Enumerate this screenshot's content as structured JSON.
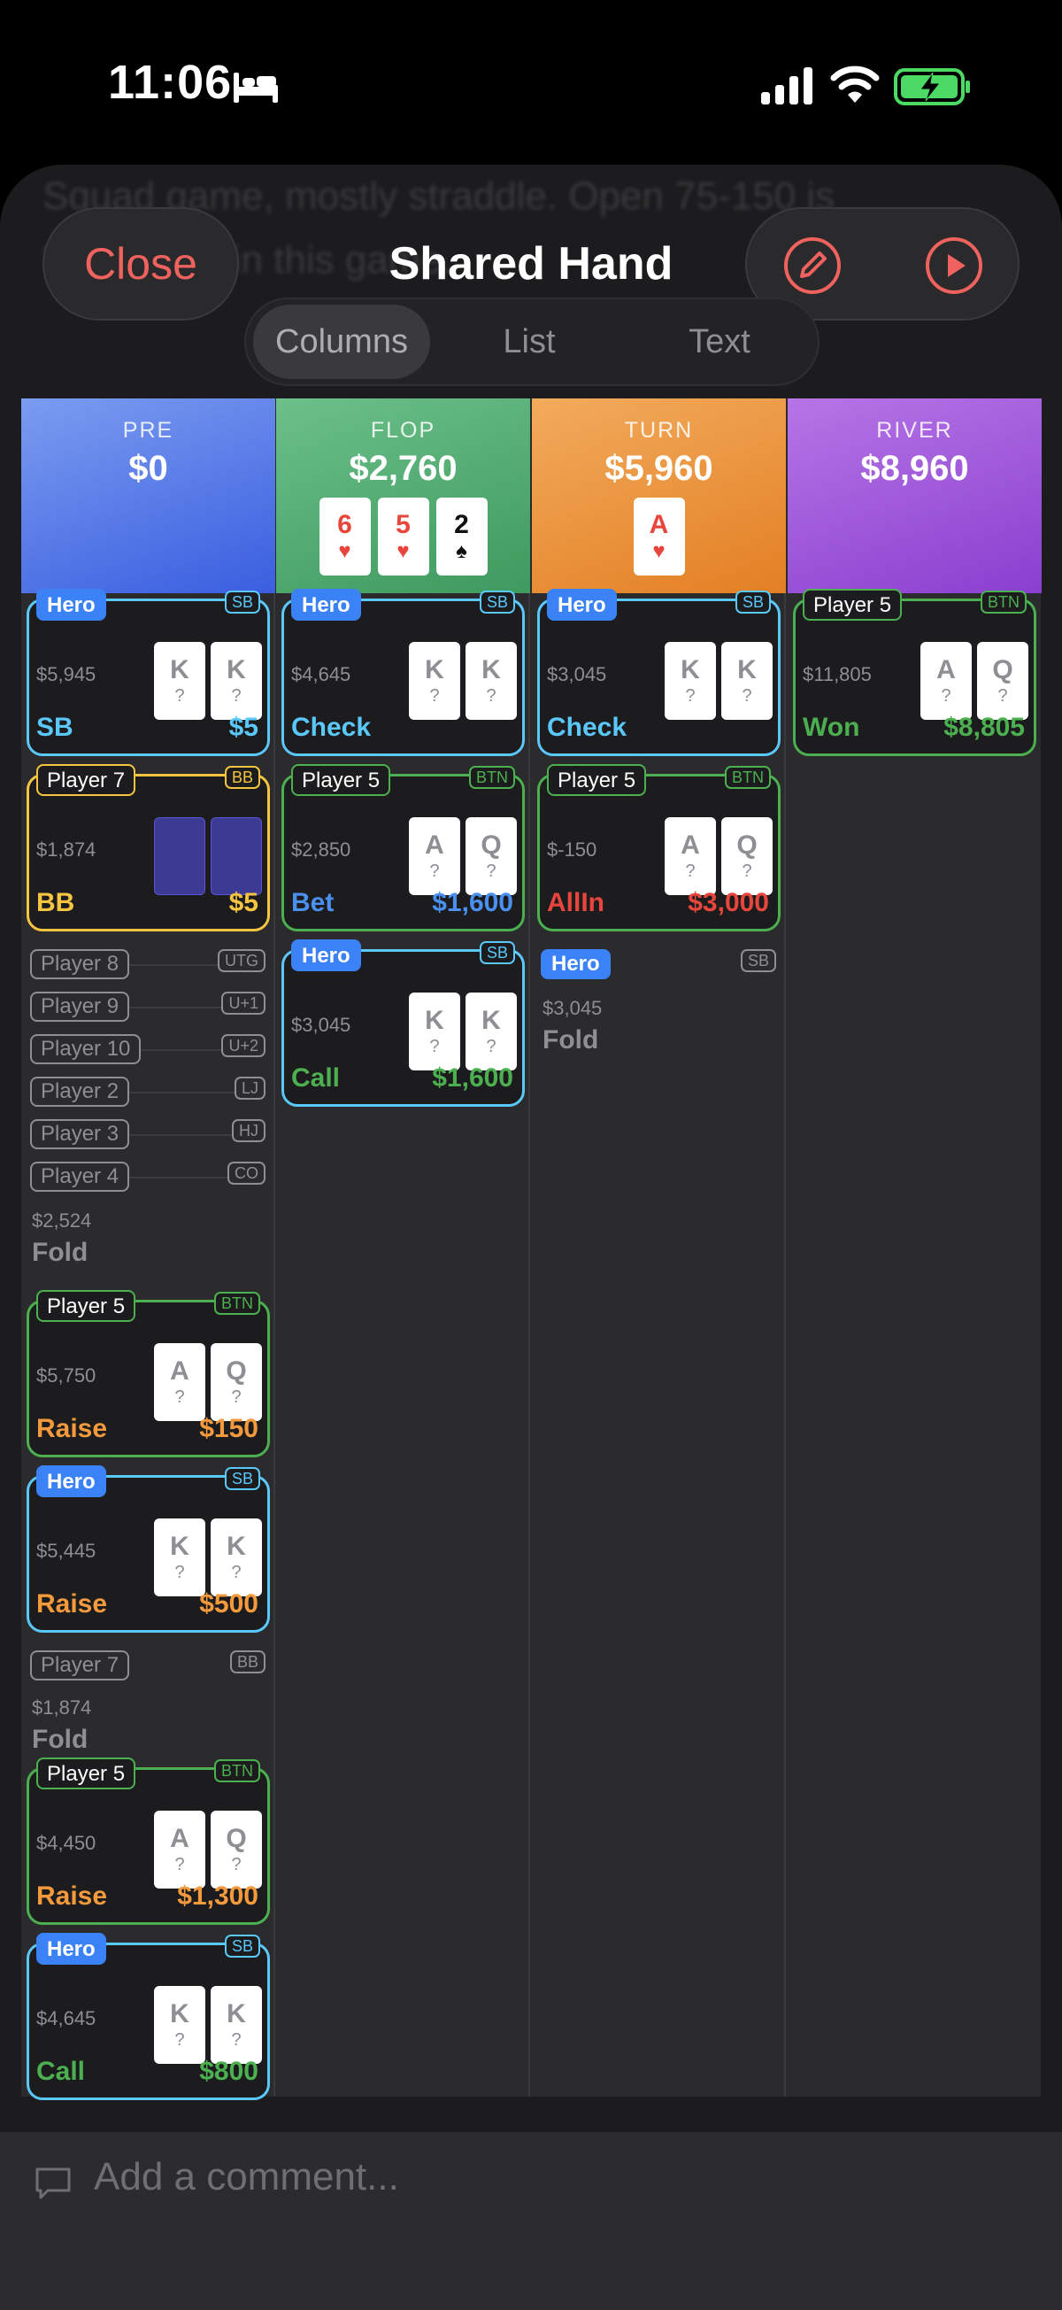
{
  "status": {
    "time": "11:06"
  },
  "ghost": {
    "line1": "Squad game, mostly straddle. Open 75-150 is",
    "line2": "\"standard\" in this game."
  },
  "header": {
    "close_label": "Close",
    "title": "Shared Hand"
  },
  "tabs": [
    {
      "label": "Columns",
      "active": true
    },
    {
      "label": "List"
    },
    {
      "label": "Text"
    }
  ],
  "colors": {
    "hero": "#5ac8fa",
    "player7": "#f5c542",
    "player5": "#4caf50",
    "accent": "#f0625e"
  },
  "streets": [
    {
      "name": "PRE",
      "pot": "$0"
    },
    {
      "name": "FLOP",
      "pot": "$2,760",
      "board": [
        {
          "rank": "6",
          "suit": "♥"
        },
        {
          "rank": "5",
          "suit": "♥"
        },
        {
          "rank": "2",
          "suit": "♠"
        }
      ]
    },
    {
      "name": "TURN",
      "pot": "$5,960",
      "board": [
        {
          "rank": "A",
          "suit": "♥"
        }
      ]
    },
    {
      "name": "RIVER",
      "pot": "$8,960"
    }
  ],
  "pre": {
    "hero_sb": {
      "name": "Hero",
      "pos": "SB",
      "stack": "$5,945",
      "c1": "K",
      "c2": "K",
      "q": "?",
      "action": "SB",
      "amount": "$5"
    },
    "p7_bb": {
      "name": "Player 7",
      "pos": "BB",
      "stack": "$1,874",
      "action": "BB",
      "amount": "$5"
    },
    "folds": [
      {
        "name": "Player 8",
        "pos": "UTG"
      },
      {
        "name": "Player 9",
        "pos": "U+1"
      },
      {
        "name": "Player 10",
        "pos": "U+2"
      },
      {
        "name": "Player 2",
        "pos": "LJ"
      },
      {
        "name": "Player 3",
        "pos": "HJ"
      },
      {
        "name": "Player 4",
        "pos": "CO"
      }
    ],
    "fold_stack": "$2,524",
    "fold_label": "Fold",
    "p5_raise": {
      "name": "Player 5",
      "pos": "BTN",
      "stack": "$5,750",
      "c1": "A",
      "c2": "Q",
      "q": "?",
      "action": "Raise",
      "amount": "$150"
    },
    "hero_raise": {
      "name": "Hero",
      "pos": "SB",
      "stack": "$5,445",
      "c1": "K",
      "c2": "K",
      "q": "?",
      "action": "Raise",
      "amount": "$500"
    },
    "p7_fold": {
      "name": "Player 7",
      "pos": "BB",
      "stack": "$1,874",
      "action": "Fold"
    },
    "p5_raise2": {
      "name": "Player 5",
      "pos": "BTN",
      "stack": "$4,450",
      "c1": "A",
      "c2": "Q",
      "q": "?",
      "action": "Raise",
      "amount": "$1,300"
    },
    "hero_call": {
      "name": "Hero",
      "pos": "SB",
      "stack": "$4,645",
      "c1": "K",
      "c2": "K",
      "q": "?",
      "action": "Call",
      "amount": "$800"
    }
  },
  "flop": {
    "hero_check": {
      "name": "Hero",
      "pos": "SB",
      "stack": "$4,645",
      "c1": "K",
      "c2": "K",
      "q": "?",
      "action": "Check"
    },
    "p5_bet": {
      "name": "Player 5",
      "pos": "BTN",
      "stack": "$2,850",
      "c1": "A",
      "c2": "Q",
      "q": "?",
      "action": "Bet",
      "amount": "$1,600"
    },
    "hero_call": {
      "name": "Hero",
      "pos": "SB",
      "stack": "$3,045",
      "c1": "K",
      "c2": "K",
      "q": "?",
      "action": "Call",
      "amount": "$1,600"
    }
  },
  "turn": {
    "hero_check": {
      "name": "Hero",
      "pos": "SB",
      "stack": "$3,045",
      "c1": "K",
      "c2": "K",
      "q": "?",
      "action": "Check"
    },
    "p5_allin": {
      "name": "Player 5",
      "pos": "BTN",
      "stack": "$-150",
      "c1": "A",
      "c2": "Q",
      "q": "?",
      "action": "AllIn",
      "amount": "$3,000"
    },
    "hero_fold": {
      "name": "Hero",
      "pos": "SB",
      "stack": "$3,045",
      "action": "Fold"
    }
  },
  "river": {
    "p5_won": {
      "name": "Player 5",
      "pos": "BTN",
      "stack": "$11,805",
      "c1": "A",
      "c2": "Q",
      "q": "?",
      "action": "Won",
      "amount": "$8,805"
    }
  },
  "comment": {
    "placeholder": "Add a comment..."
  }
}
